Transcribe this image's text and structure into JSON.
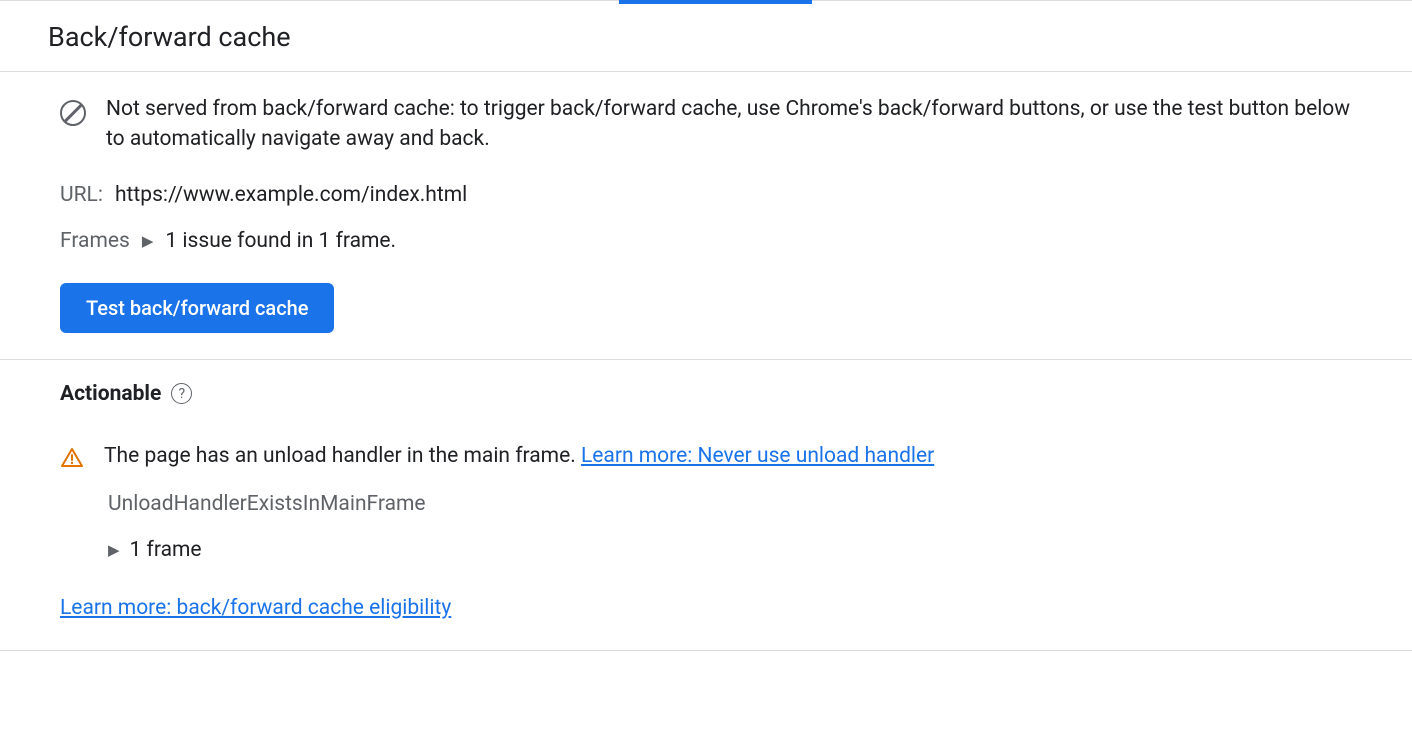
{
  "header": {
    "title": "Back/forward cache"
  },
  "status": {
    "message": "Not served from back/forward cache: to trigger back/forward cache, use Chrome's back/forward buttons, or use the test button below to automatically navigate away and back."
  },
  "url": {
    "label": "URL:",
    "value": "https://www.example.com/index.html"
  },
  "frames": {
    "label": "Frames",
    "summary": "1 issue found in 1 frame."
  },
  "test_button": {
    "label": "Test back/forward cache"
  },
  "actionable": {
    "title": "Actionable",
    "issue": {
      "description": "The page has an unload handler in the main frame. ",
      "learn_more_text": "Learn more: Never use unload handler",
      "reason_id": "UnloadHandlerExistsInMainFrame",
      "frame_count": "1 frame"
    },
    "eligibility_link": "Learn more: back/forward cache eligibility"
  }
}
